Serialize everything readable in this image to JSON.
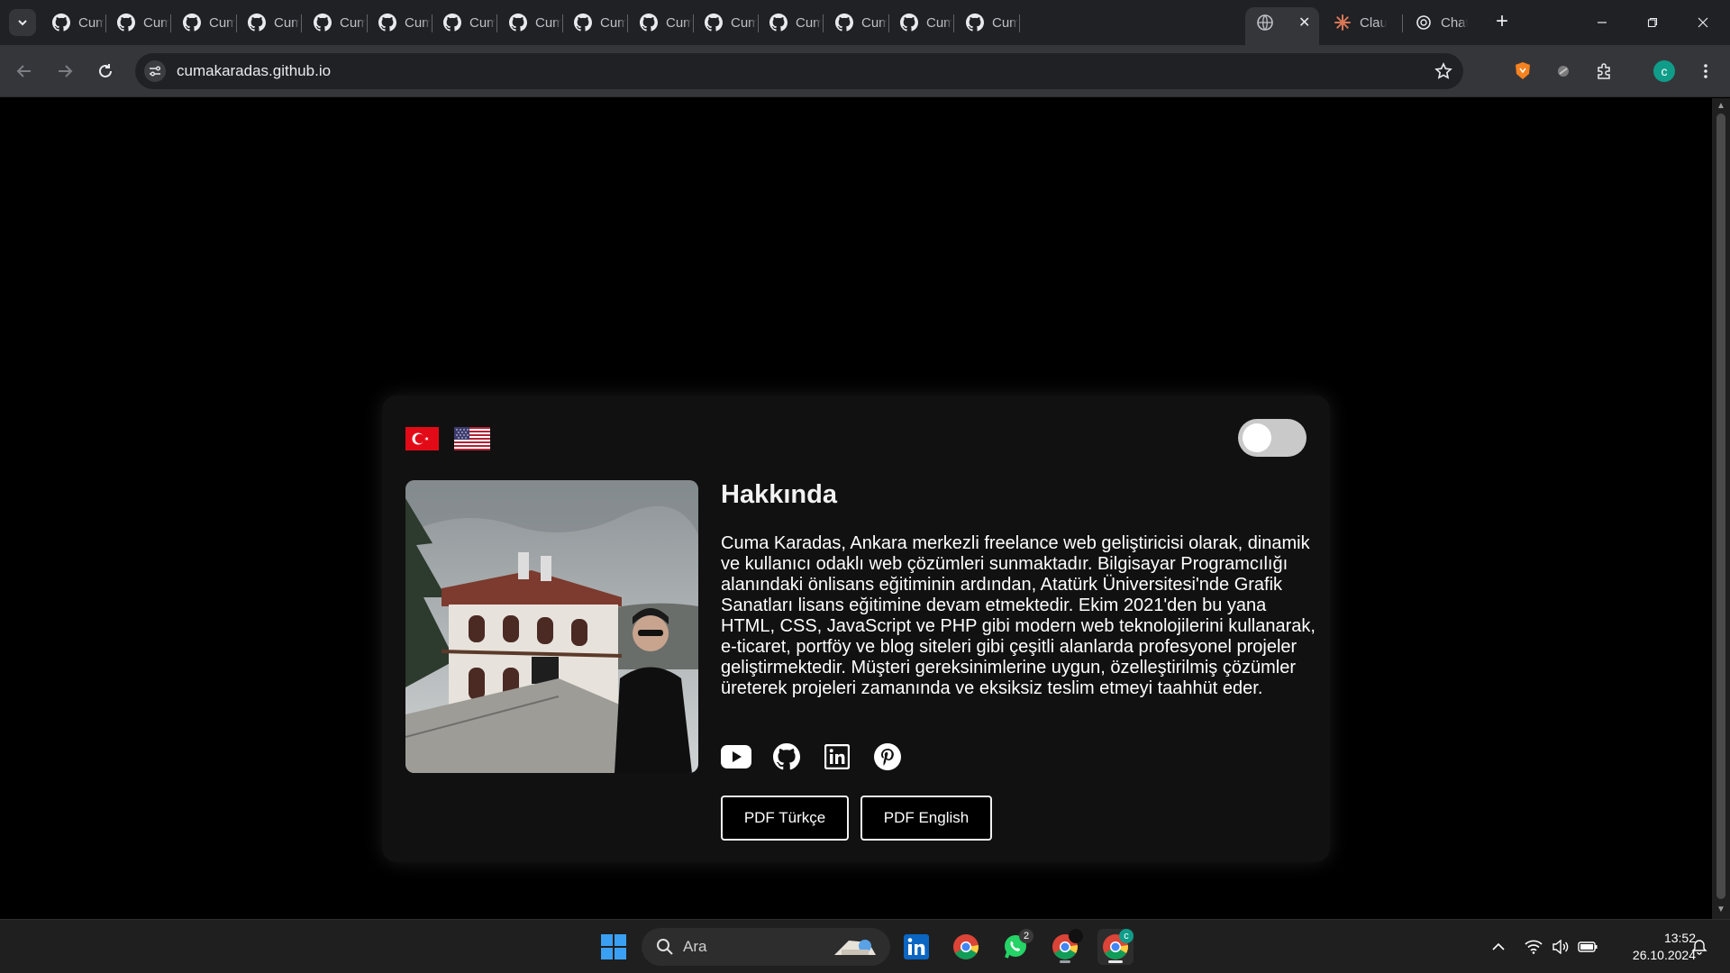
{
  "browser": {
    "tabs": [
      {
        "title": "Cum",
        "icon": "github-icon"
      },
      {
        "title": "Cum",
        "icon": "github-icon"
      },
      {
        "title": "Cum",
        "icon": "github-icon"
      },
      {
        "title": "Cum",
        "icon": "github-icon"
      },
      {
        "title": "Cum",
        "icon": "github-icon"
      },
      {
        "title": "Cum",
        "icon": "github-icon"
      },
      {
        "title": "Cum",
        "icon": "github-icon"
      },
      {
        "title": "Cum",
        "icon": "github-icon"
      },
      {
        "title": "Cum",
        "icon": "github-icon"
      },
      {
        "title": "Cum",
        "icon": "github-icon"
      },
      {
        "title": "Cum",
        "icon": "github-icon"
      },
      {
        "title": "Cum",
        "icon": "github-icon"
      },
      {
        "title": "Cum",
        "icon": "github-icon"
      },
      {
        "title": "Cum",
        "icon": "github-icon"
      },
      {
        "title": "Cum",
        "icon": "github-icon"
      }
    ],
    "active_tab": {
      "title": "",
      "icon": "globe-icon"
    },
    "other_tabs": [
      {
        "title": "Clau",
        "icon": "claude-icon"
      },
      {
        "title": "Chat",
        "icon": "chatgpt-icon"
      }
    ],
    "url": "cumakaradas.github.io"
  },
  "page": {
    "flags": [
      {
        "name": "Turkish flag",
        "icon": "turkey-flag-icon"
      },
      {
        "name": "US flag",
        "icon": "us-flag-icon"
      }
    ],
    "theme_toggle": {
      "state": "off"
    },
    "about_title": "Hakkında",
    "about_text": "Cuma Karadas, Ankara merkezli freelance web geliştiricisi olarak, dinamik ve kullanıcı odaklı web çözümleri sunmaktadır. Bilgisayar Programcılığı alanındaki önlisans eğitiminin ardından, Atatürk Üniversitesi'nde Grafik Sanatları lisans eğitimine devam etmektedir. Ekim 2021'den bu yana HTML, CSS, JavaScript ve PHP gibi modern web teknolojilerini kullanarak, e-ticaret, portföy ve blog siteleri gibi çeşitli alanlarda profesyonel projeler geliştirmektedir. Müşteri gereksinimlerine uygun, özelleştirilmiş çözümler üreterek projeleri zamanında ve eksiksiz teslim etmeyi taahhüt eder.",
    "socials": [
      "youtube-icon",
      "github-icon",
      "linkedin-icon",
      "pinterest-icon"
    ],
    "pdf_tr_label": "PDF Türkçe",
    "pdf_en_label": "PDF English"
  },
  "taskbar": {
    "search_placeholder": "Ara",
    "whatsapp_badge": "2",
    "time": "13:52",
    "date": "26.10.2024"
  },
  "colors": {
    "page_bg": "#000000",
    "card_bg": "#111111",
    "toggle_bg": "#c9c9c9",
    "chrome_dark": "#202124",
    "chrome_toolbar": "#35363a"
  }
}
